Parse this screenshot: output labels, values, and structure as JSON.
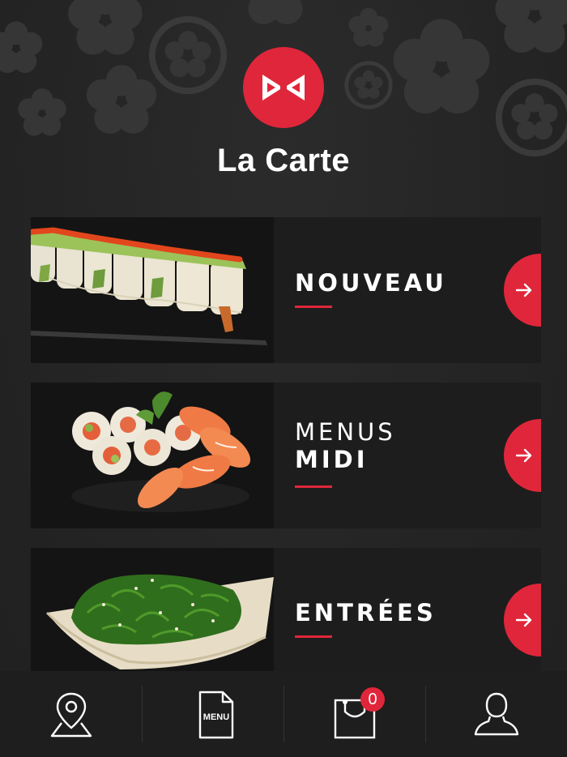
{
  "header": {
    "title": "La Carte",
    "logo_icon": "bowtie-icon",
    "accent_color": "#e0263a"
  },
  "categories": [
    {
      "lines": [
        {
          "text": "NOUVEAU",
          "weight": "bold"
        }
      ],
      "image": "sushi-roll-photo",
      "action_icon": "arrow-right-icon"
    },
    {
      "lines": [
        {
          "text": "MENUS",
          "weight": "light"
        },
        {
          "text": "MIDI",
          "weight": "bold"
        }
      ],
      "image": "sushi-platter-photo",
      "action_icon": "arrow-right-icon"
    },
    {
      "lines": [
        {
          "text": "ENTRÉES",
          "weight": "bold"
        }
      ],
      "image": "seaweed-salad-photo",
      "action_icon": "arrow-right-icon"
    }
  ],
  "tabbar": {
    "items": [
      {
        "icon": "map-pin-icon"
      },
      {
        "icon": "menu-document-icon",
        "label": "MENU"
      },
      {
        "icon": "shopping-bag-icon",
        "badge": "0"
      },
      {
        "icon": "user-icon"
      }
    ]
  }
}
